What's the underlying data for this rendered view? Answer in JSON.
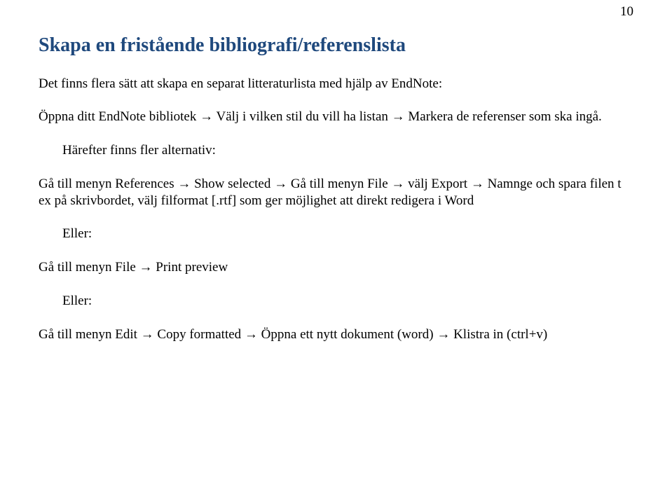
{
  "page_number": "10",
  "heading": "Skapa en fristående bibliografi/referenslista",
  "intro": "Det finns flera sätt att skapa en separat litteraturlista med hjälp av EndNote:",
  "step1": "Öppna ditt EndNote bibliotek → Välj i vilken stil du vill ha listan → Markera de referenser som ska ingå.",
  "alt_intro": "Härefter finns fler alternativ:",
  "alt1": "Gå till menyn References → Show selected →  Gå till menyn File → välj Export → Namnge och spara filen t ex på skrivbordet, välj filformat [.rtf] som ger möjlighet att direkt redigera i Word",
  "or1": "Eller:",
  "alt2": "Gå till menyn File → Print preview",
  "or2": "Eller:",
  "alt3": "Gå till menyn Edit → Copy formatted → Öppna ett nytt dokument (word) →  Klistra in (ctrl+v)"
}
